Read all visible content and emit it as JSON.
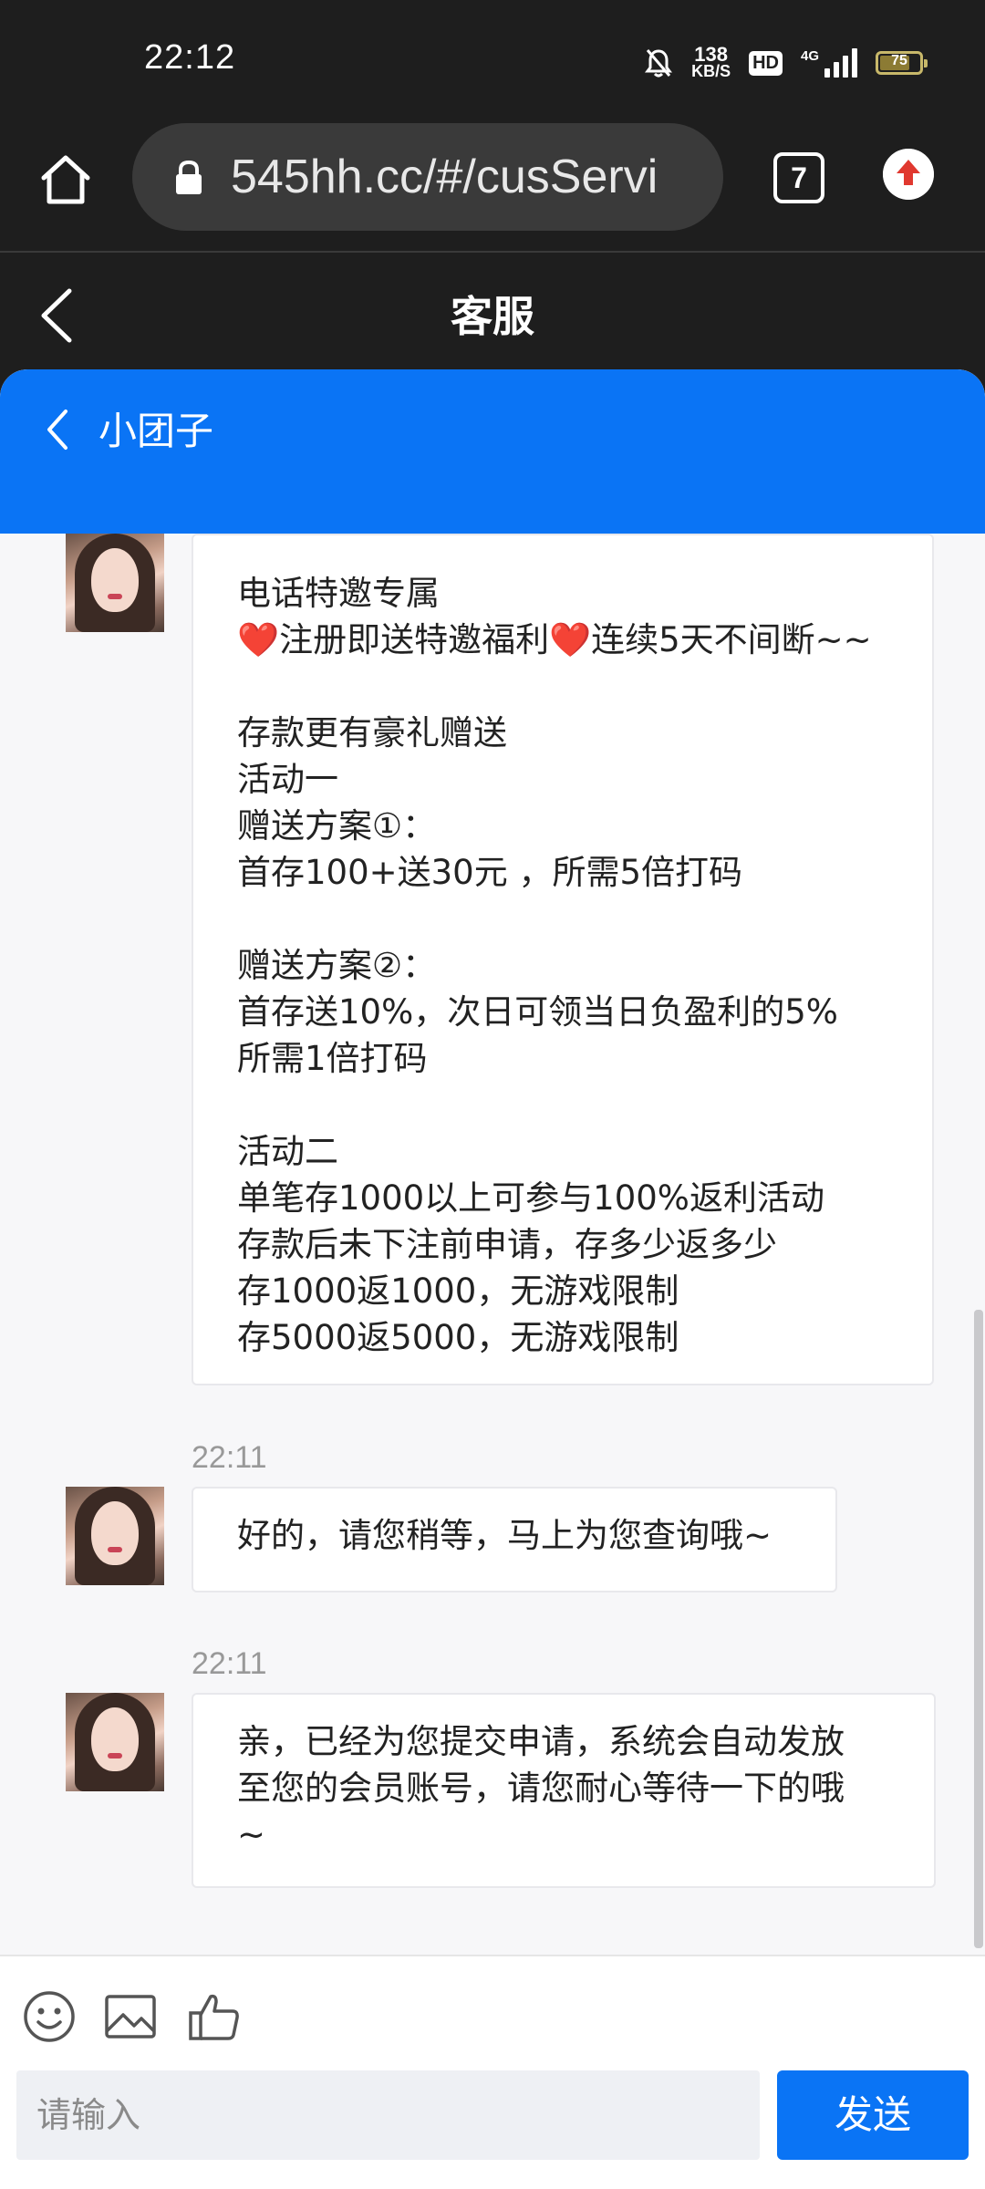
{
  "status_bar": {
    "time": "22:12",
    "net_speed_value": "138",
    "net_speed_unit": "KB/S",
    "hd_label": "HD",
    "network_label": "4G",
    "battery_level": "75"
  },
  "browser": {
    "url": "545hh.cc/#/cusServi",
    "tab_count": "7"
  },
  "page": {
    "title": "客服"
  },
  "chat": {
    "agent_name": "小团子",
    "messages": [
      {
        "timestamp": "",
        "text": "电话特邀专属\n❤️注册即送特邀福利❤️连续5天不间断~~\n\n存款更有豪礼赠送\n活动一\n赠送方案①：\n首存100+送30元 ，所需5倍打码\n\n赠送方案②：\n首存送10%，次日可领当日负盈利的5%\n所需1倍打码\n\n活动二\n单笔存1000以上可参与100%返利活动\n存款后未下注前申请，存多少返多少\n存1000返1000，无游戏限制\n存5000返5000，无游戏限制"
      },
      {
        "timestamp": "22:11",
        "text": "好的，请您稍等，马上为您查询哦~"
      },
      {
        "timestamp": "22:11",
        "text": "亲，已经为您提交申请，系统会自动发放\n至您的会员账号，请您耐心等待一下的哦\n~"
      }
    ]
  },
  "composer": {
    "placeholder": "请输入",
    "send_label": "发送",
    "tools": [
      "emoji-icon",
      "image-icon",
      "thumbs-up-icon"
    ]
  },
  "colors": {
    "accent": "#0a74f5",
    "dark_bg": "#1e1e1e",
    "chat_bg": "#f7f7f9"
  }
}
